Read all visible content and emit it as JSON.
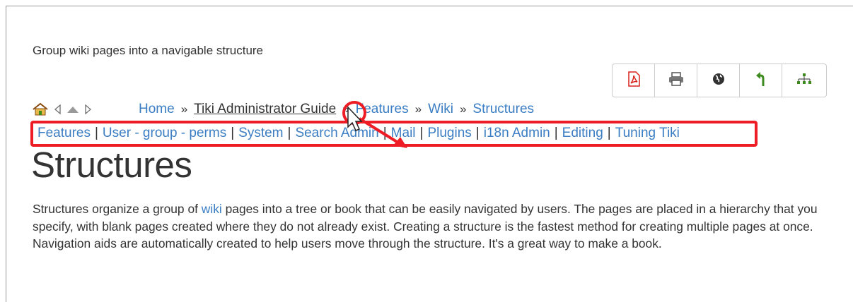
{
  "page": {
    "description": "Group wiki pages into a navigable structure",
    "title": "Structures"
  },
  "toolbar": {
    "buttons": [
      {
        "name": "pdf-icon",
        "color": "#d9231d"
      },
      {
        "name": "print-icon",
        "color": "#555555"
      },
      {
        "name": "globe-icon",
        "color": "#333333"
      },
      {
        "name": "back-arrow-icon",
        "color": "#3d8b1f"
      },
      {
        "name": "structure-tree-icon",
        "color": "#3d8b1f"
      }
    ]
  },
  "breadcrumb": {
    "items": [
      "Home",
      "Tiki Administrator Guide",
      "Features",
      "Wiki",
      "Structures"
    ],
    "separator": "»"
  },
  "toc": {
    "items": [
      "Features",
      "User - group - perms",
      "System",
      "Search Admin",
      "Mail",
      "Plugins",
      "i18n Admin",
      "Editing",
      "Tuning Tiki"
    ],
    "separator": "|"
  },
  "body": {
    "part1": "Structures organize a group of ",
    "link": "wiki",
    "part2": " pages into a tree or book that can be easily navigated by users. The pages are placed in a hierarchy that you specify, with blank pages created where they do not already exist. Creating a structure is the fastest method for creating multiple pages at once. Navigation aids are automatically created to help users move through the structure. It's a great way to make a book."
  },
  "colors": {
    "link": "#3a7dc3",
    "annotation": "#ee1c24",
    "text": "#333333"
  }
}
